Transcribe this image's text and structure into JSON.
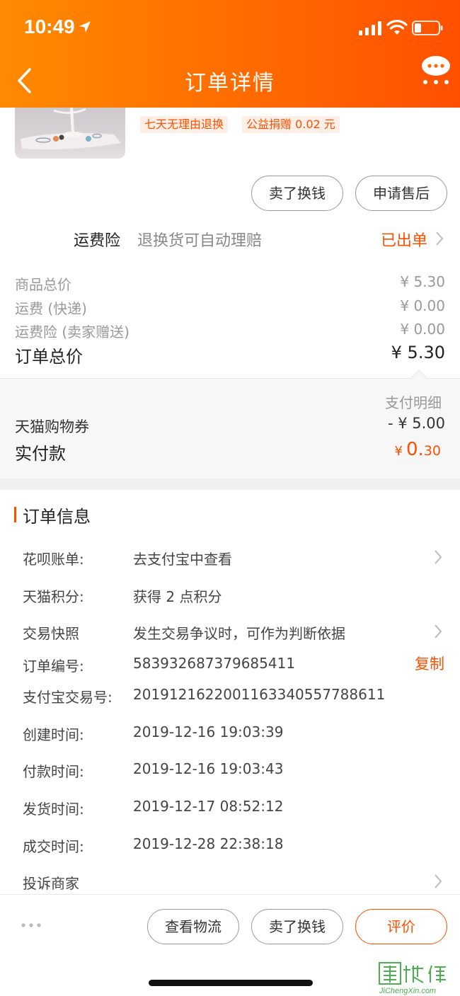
{
  "status_bar": {
    "time": "10:49"
  },
  "nav": {
    "title": "订单详情"
  },
  "product": {
    "tags": [
      "七天无理由退换",
      "公益捐赠 0.02 元"
    ]
  },
  "item_actions": {
    "sell_label": "卖了换钱",
    "after_sale_label": "申请售后"
  },
  "insurance": {
    "label": "运费险",
    "desc": "退换货可自动理赔",
    "status": "已出单"
  },
  "price": {
    "rows": [
      {
        "label": "商品总价",
        "value": "¥ 5.30"
      },
      {
        "label": "运费 (快递)",
        "value": "¥ 0.00"
      },
      {
        "label": "运费险 (卖家赠送)",
        "value": "¥ 0.00"
      }
    ],
    "total_label": "订单总价",
    "total_value": "¥ 5.30"
  },
  "payment": {
    "detail_label": "支付明细",
    "coupon_label": "天猫购物券",
    "coupon_value": "- ¥ 5.00",
    "paid_label": "实付款",
    "paid_currency": "¥",
    "paid_int": "0.",
    "paid_dec": "30"
  },
  "order_info": {
    "title": "订单信息",
    "rows": [
      {
        "label": "花呗账单:",
        "value": "去支付宝中查看"
      },
      {
        "label": "天猫积分:",
        "value": "获得 2 点积分"
      },
      {
        "label": "交易快照",
        "value": "发生交易争议时，可作为判断依据"
      },
      {
        "label": "订单编号:",
        "value": "583932687379685411"
      },
      {
        "label": "支付宝交易号:",
        "value": "2019121622001163340557788611"
      },
      {
        "label": "创建时间:",
        "value": "2019-12-16 19:03:39"
      },
      {
        "label": "付款时间:",
        "value": "2019-12-16 19:03:43"
      },
      {
        "label": "发货时间:",
        "value": "2019-12-17 08:52:12"
      },
      {
        "label": "成交时间:",
        "value": "2019-12-28 22:38:18"
      },
      {
        "label": "投诉商家",
        "value": ""
      }
    ],
    "copy_label": "复制"
  },
  "bottom_actions": {
    "logistics_label": "查看物流",
    "sell_label": "卖了换钱",
    "review_label": "评价"
  },
  "watermark": {
    "text": "JiChengXin.com",
    "logo_chars": "集诚信"
  },
  "colors": {
    "accent": "#ff5000",
    "header_start": "#ff8a00",
    "header_end": "#ff5000"
  }
}
